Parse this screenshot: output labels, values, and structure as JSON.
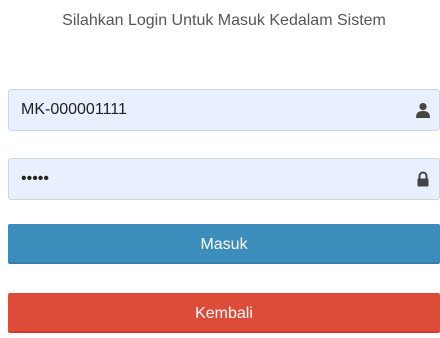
{
  "heading": "Silahkan Login Untuk Masuk Kedalam Sistem",
  "form": {
    "username_value": "MK-000001111",
    "password_value": "•••••"
  },
  "buttons": {
    "masuk_label": "Masuk",
    "kembali_label": "Kembali"
  },
  "icons": {
    "username": "user-icon",
    "password": "lock-icon"
  },
  "colors": {
    "input_background": "#e8f0fe",
    "masuk": "#3c8dbc",
    "kembali": "#dd4b39",
    "heading_text": "#555555",
    "icon": "#444444"
  }
}
